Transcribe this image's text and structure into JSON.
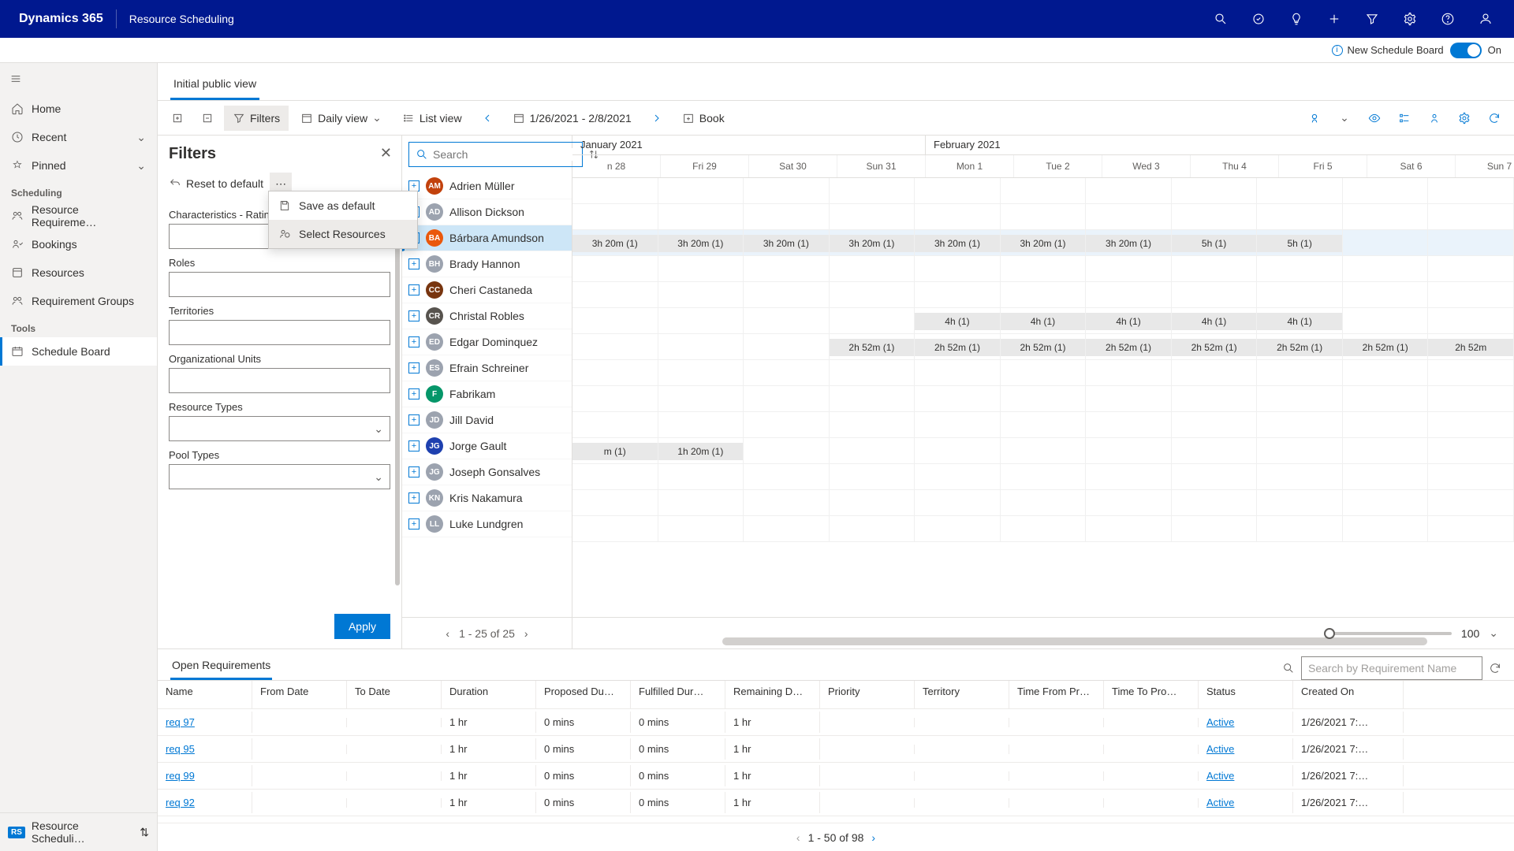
{
  "topbar": {
    "brand": "Dynamics 365",
    "app": "Resource Scheduling"
  },
  "nsb": {
    "label": "New Schedule Board",
    "on": "On"
  },
  "nav": {
    "home": "Home",
    "recent": "Recent",
    "pinned": "Pinned",
    "section_scheduling": "Scheduling",
    "resource_requirements": "Resource Requireme…",
    "bookings": "Bookings",
    "resources": "Resources",
    "requirement_groups": "Requirement Groups",
    "section_tools": "Tools",
    "schedule_board": "Schedule Board",
    "footer_badge": "RS",
    "footer_label": "Resource Scheduli…"
  },
  "viewtab": "Initial public view",
  "toolbar": {
    "filters": "Filters",
    "daily": "Daily view",
    "list": "List view",
    "date_range": "1/26/2021 - 2/8/2021",
    "book": "Book"
  },
  "filters": {
    "title": "Filters",
    "reset": "Reset to default",
    "menu_save": "Save as default",
    "menu_select": "Select Resources",
    "lbl_char": "Characteristics - Ratin",
    "lbl_roles": "Roles",
    "lbl_terr": "Territories",
    "lbl_org": "Organizational Units",
    "lbl_rtypes": "Resource Types",
    "lbl_ptypes": "Pool Types",
    "apply": "Apply"
  },
  "res_search_placeholder": "Search",
  "resources": [
    {
      "name": "Adrien Müller",
      "initials": "AM",
      "avatar": "#c2410c"
    },
    {
      "name": "Allison Dickson",
      "initials": "AD",
      "avatar": "#9ca3af"
    },
    {
      "name": "Bárbara Amundson",
      "initials": "BA",
      "avatar": "#ea580c",
      "selected": true
    },
    {
      "name": "Brady Hannon",
      "initials": "BH",
      "avatar": "#9ca3af"
    },
    {
      "name": "Cheri Castaneda",
      "initials": "CC",
      "avatar": "#78350f"
    },
    {
      "name": "Christal Robles",
      "initials": "CR",
      "avatar": "#57534e"
    },
    {
      "name": "Edgar Dominquez",
      "initials": "ED",
      "avatar": "#9ca3af"
    },
    {
      "name": "Efrain Schreiner",
      "initials": "ES",
      "avatar": "#9ca3af"
    },
    {
      "name": "Fabrikam",
      "initials": "F",
      "avatar": "#059669"
    },
    {
      "name": "Jill David",
      "initials": "JD",
      "avatar": "#9ca3af"
    },
    {
      "name": "Jorge Gault",
      "initials": "JG",
      "avatar": "#1e40af"
    },
    {
      "name": "Joseph Gonsalves",
      "initials": "JG",
      "avatar": "#9ca3af"
    },
    {
      "name": "Kris Nakamura",
      "initials": "KN",
      "avatar": "#9ca3af"
    },
    {
      "name": "Luke Lundgren",
      "initials": "LL",
      "avatar": "#9ca3af"
    }
  ],
  "res_pager": "1 - 25 of 25",
  "timeline": {
    "months": [
      {
        "label": "January 2021",
        "days": [
          "n 28",
          "Fri 29",
          "Sat 30",
          "Sun 31"
        ]
      },
      {
        "label": "February 2021",
        "days": [
          "Mon 1",
          "Tue 2",
          "Wed 3",
          "Thu 4",
          "Fri 5",
          "Sat 6",
          "Sun 7"
        ]
      }
    ],
    "rows": [
      {
        "cells": [
          "",
          "",
          "",
          "",
          "",
          "",
          "",
          "",
          "",
          "",
          ""
        ]
      },
      {
        "cells": [
          "",
          "",
          "",
          "",
          "",
          "",
          "",
          "",
          "",
          "",
          ""
        ]
      },
      {
        "selected": true,
        "cells": [
          "3h 20m (1)",
          "3h 20m (1)",
          "3h 20m (1)",
          "3h 20m (1)",
          "3h 20m (1)",
          "3h 20m (1)",
          "3h 20m (1)",
          "5h (1)",
          "5h (1)",
          "",
          ""
        ]
      },
      {
        "cells": [
          "",
          "",
          "",
          "",
          "",
          "",
          "",
          "",
          "",
          "",
          ""
        ]
      },
      {
        "cells": [
          "",
          "",
          "",
          "",
          "",
          "",
          "",
          "",
          "",
          "",
          ""
        ]
      },
      {
        "cells": [
          "",
          "",
          "",
          "",
          "4h (1)",
          "4h (1)",
          "4h (1)",
          "4h (1)",
          "4h (1)",
          "",
          ""
        ]
      },
      {
        "cells": [
          "",
          "",
          "",
          "2h 52m (1)",
          "2h 52m (1)",
          "2h 52m (1)",
          "2h 52m (1)",
          "2h 52m (1)",
          "2h 52m (1)",
          "2h 52m (1)",
          "2h 52m"
        ]
      },
      {
        "cells": [
          "",
          "",
          "",
          "",
          "",
          "",
          "",
          "",
          "",
          "",
          ""
        ]
      },
      {
        "cells": [
          "",
          "",
          "",
          "",
          "",
          "",
          "",
          "",
          "",
          "",
          ""
        ]
      },
      {
        "cells": [
          "",
          "",
          "",
          "",
          "",
          "",
          "",
          "",
          "",
          "",
          ""
        ]
      },
      {
        "cells": [
          "m (1)",
          "1h 20m (1)",
          "",
          "",
          "",
          "",
          "",
          "",
          "",
          "",
          ""
        ]
      },
      {
        "cells": [
          "",
          "",
          "",
          "",
          "",
          "",
          "",
          "",
          "",
          "",
          ""
        ]
      },
      {
        "cells": [
          "",
          "",
          "",
          "",
          "",
          "",
          "",
          "",
          "",
          "",
          ""
        ]
      },
      {
        "cells": [
          "",
          "",
          "",
          "",
          "",
          "",
          "",
          "",
          "",
          "",
          ""
        ]
      }
    ]
  },
  "zoom_value": "100",
  "req": {
    "tab": "Open Requirements",
    "search_placeholder": "Search by Requirement Name",
    "headers": {
      "name": "Name",
      "from": "From Date",
      "to": "To Date",
      "dur": "Duration",
      "prop": "Proposed Du…",
      "ful": "Fulfilled Dur…",
      "rem": "Remaining D…",
      "pri": "Priority",
      "ter": "Territory",
      "tfp": "Time From Pr…",
      "ttp": "Time To Pro…",
      "stat": "Status",
      "created": "Created On"
    },
    "rows": [
      {
        "name": "req 97",
        "dur": "1 hr",
        "prop": "0 mins",
        "ful": "0 mins",
        "rem": "1 hr",
        "stat": "Active",
        "created": "1/26/2021 7:…"
      },
      {
        "name": "req 95",
        "dur": "1 hr",
        "prop": "0 mins",
        "ful": "0 mins",
        "rem": "1 hr",
        "stat": "Active",
        "created": "1/26/2021 7:…"
      },
      {
        "name": "req 99",
        "dur": "1 hr",
        "prop": "0 mins",
        "ful": "0 mins",
        "rem": "1 hr",
        "stat": "Active",
        "created": "1/26/2021 7:…"
      },
      {
        "name": "req 92",
        "dur": "1 hr",
        "prop": "0 mins",
        "ful": "0 mins",
        "rem": "1 hr",
        "stat": "Active",
        "created": "1/26/2021 7:…"
      }
    ],
    "pager": "1 - 50 of 98"
  }
}
